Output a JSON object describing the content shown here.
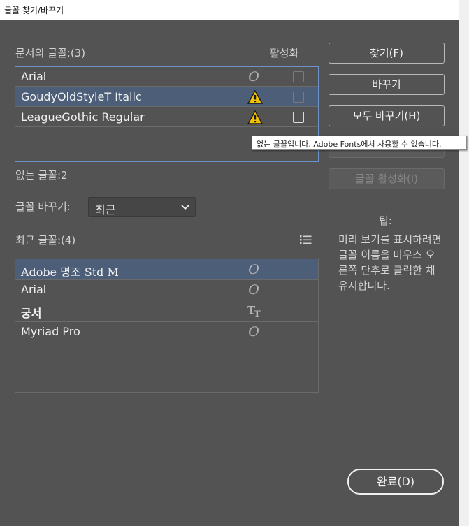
{
  "window": {
    "title": "글꼴 찾기/바꾸기"
  },
  "document_fonts": {
    "label": "문서의 글꼴:(3)",
    "activate_header": "활성화",
    "items": [
      {
        "name": "Arial",
        "status": "opentype-icon",
        "selected": false,
        "checkbox_enabled": false
      },
      {
        "name": "GoudyOldStyleT Italic",
        "status": "warning-icon",
        "selected": true,
        "checkbox_enabled": false
      },
      {
        "name": "LeagueGothic Regular",
        "status": "warning-icon",
        "selected": false,
        "checkbox_enabled": true
      }
    ]
  },
  "tooltip": "없는 글꼴입니다. Adobe Fonts에서 사용할 수 있습니다.",
  "missing_fonts_label": "없는 글꼴:2",
  "replace_with": {
    "label": "글꼴 바꾸기:",
    "selected": "최근"
  },
  "recent_fonts": {
    "label": "최근 글꼴:(4)",
    "items": [
      {
        "name": "Adobe 명조 Std M",
        "status": "opentype-icon",
        "selected": true
      },
      {
        "name": "Arial",
        "status": "opentype-icon",
        "selected": false
      },
      {
        "name": "궁서",
        "status": "truetype-icon",
        "selected": false
      },
      {
        "name": "Myriad Pro",
        "status": "opentype-icon",
        "selected": false
      }
    ]
  },
  "buttons": {
    "find": "찾기(F)",
    "replace": "바꾸기",
    "replace_all": "모두 바꾸기(H)",
    "activate": "글꼴 활성화(I)",
    "done": "완료(D)"
  },
  "tip": {
    "title": "팁:",
    "text": "미리 보기를 표시하려면 글꼴 이름을 마우스 오른쪽 단추로 클릭한 채 유지합니다."
  },
  "colors": {
    "dialog_bg": "#535353",
    "selection": "#4d5f78",
    "warning": "#f2c200"
  }
}
